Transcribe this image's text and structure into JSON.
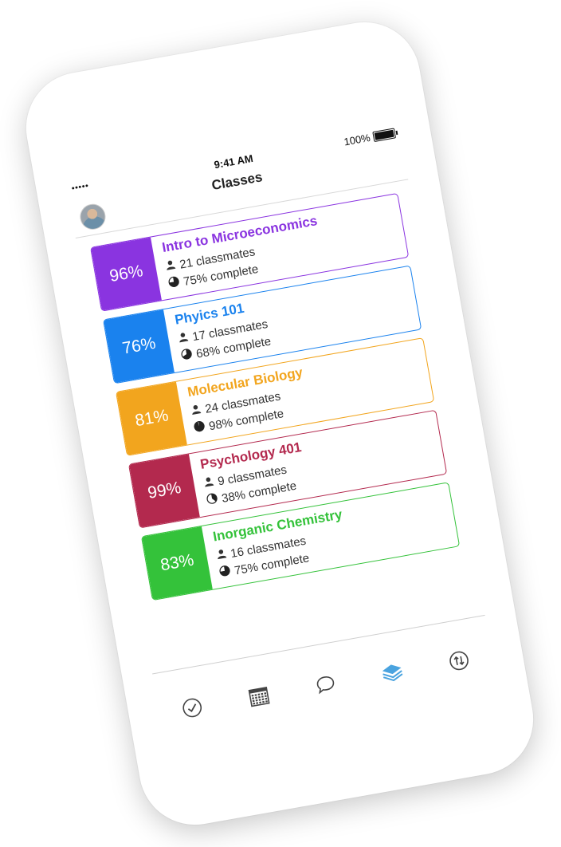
{
  "status_bar": {
    "signal": "•••••",
    "time": "9:41 AM",
    "battery_text": "100%",
    "battery_level": 1.0
  },
  "nav": {
    "title": "Classes"
  },
  "classes": [
    {
      "name": "Intro to Microeconomics",
      "grade": "96%",
      "classmates": "21 classmates",
      "complete": "75% complete",
      "complete_level": 0.75,
      "color": "#8a34e0"
    },
    {
      "name": "Phyics 101",
      "grade": "76%",
      "classmates": "17 classmates",
      "complete": "68% complete",
      "complete_level": 0.68,
      "color": "#1a82ee"
    },
    {
      "name": "Molecular Biology",
      "grade": "81%",
      "classmates": "24 classmates",
      "complete": "98% complete",
      "complete_level": 0.98,
      "color": "#f2a51e"
    },
    {
      "name": "Psychology 401",
      "grade": "99%",
      "classmates": "9 classmates",
      "complete": "38% complete",
      "complete_level": 0.38,
      "color": "#b3294e"
    },
    {
      "name": "Inorganic Chemistry",
      "grade": "83%",
      "classmates": "16 classmates",
      "complete": "75% complete",
      "complete_level": 0.75,
      "color": "#34c23a"
    }
  ],
  "tabs": [
    {
      "icon": "checkmark-circle-icon",
      "active": false
    },
    {
      "icon": "calendar-icon",
      "active": false
    },
    {
      "icon": "chat-bubble-icon",
      "active": false
    },
    {
      "icon": "stack-layers-icon",
      "active": true
    },
    {
      "icon": "swap-arrows-icon",
      "active": false
    }
  ],
  "colors": {
    "active_tab": "#4aa3df",
    "inactive_tab": "#444444"
  }
}
